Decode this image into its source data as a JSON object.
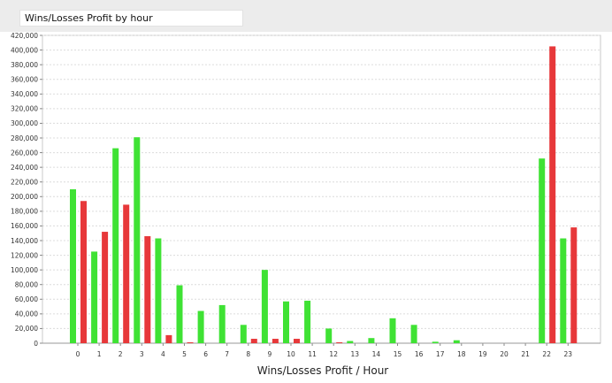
{
  "title_field": {
    "value": "Wins/Losses Profit by hour"
  },
  "chart_data": {
    "type": "bar",
    "title": "Wins/Losses Profit by hour",
    "xlabel": "Wins/Losses Profit / Hour",
    "ylabel": "",
    "ylim": [
      0,
      420000
    ],
    "y_tick_step": 20000,
    "grid": true,
    "categories": [
      "0",
      "1",
      "2",
      "3",
      "4",
      "5",
      "6",
      "7",
      "8",
      "9",
      "10",
      "11",
      "12",
      "13",
      "14",
      "15",
      "16",
      "17",
      "18",
      "19",
      "20",
      "21",
      "22",
      "23"
    ],
    "series": [
      {
        "color": "#3fe234",
        "values": [
          210000,
          125000,
          266000,
          281000,
          143000,
          79000,
          44000,
          52000,
          25000,
          100000,
          57000,
          58000,
          20000,
          3000,
          7000,
          34000,
          25000,
          2000,
          4000,
          0,
          0,
          0,
          252000,
          143000
        ]
      },
      {
        "color": "#e7383a",
        "values": [
          194000,
          152000,
          189000,
          146000,
          11000,
          500,
          0,
          0,
          6000,
          6000,
          6000,
          0,
          500,
          0,
          0,
          0,
          0,
          0,
          0,
          0,
          0,
          0,
          405000,
          158000
        ]
      }
    ]
  }
}
